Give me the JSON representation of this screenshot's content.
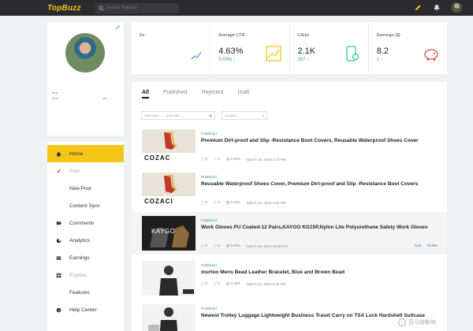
{
  "header": {
    "logo": "TopBuzz",
    "search_placeholder": "Search Topbuzz"
  },
  "profile": {
    "stat_left_label": "fans",
    "stat_left_value": "Burs",
    "stat_right_value": "ath"
  },
  "sidebar": {
    "items": [
      {
        "label": "Home"
      },
      {
        "label": "Post"
      },
      {
        "label": "New Post"
      },
      {
        "label": "Content Sync"
      },
      {
        "label": "Comments"
      },
      {
        "label": "Analytics"
      },
      {
        "label": "Earnings"
      },
      {
        "label": "Explore"
      },
      {
        "label": "Features"
      },
      {
        "label": "Help Center"
      }
    ]
  },
  "stats": {
    "first": {
      "label": "Ex"
    },
    "ctr": {
      "label": "Average CTR",
      "value": "4.63%",
      "sub": "0.03%"
    },
    "clicks": {
      "label": "Clicks",
      "value": "2.1K",
      "sub": "307"
    },
    "earnings": {
      "label": "Earnings ($)",
      "value": "8.2",
      "sub": "1"
    }
  },
  "tabs": [
    "All",
    "Published",
    "Rejected",
    "Draft"
  ],
  "filters": {
    "start": "Start Date",
    "end": "End Date",
    "types": "All types"
  },
  "posts": [
    {
      "status": "Published",
      "title": "Premium Dirt-proof and Slip -Resistance Boot Covers,  Reusable Waterproof Shoes Cover",
      "comments": "0",
      "likes": "0",
      "ctr": "2.84%",
      "date": "March 19, 2019 7:10 PM",
      "thumb_text": "COZAC"
    },
    {
      "status": "Published",
      "title": "Reusable Waterproof Shoes Cover, Premium Dirt-proof and Slip -Resistance Boot Covers",
      "comments": "0",
      "likes": "0",
      "ctr": "0.00%",
      "date": "March 19, 2019 4:32 PM",
      "thumb_text": "COZACI"
    },
    {
      "status": "Published",
      "title": "Work Gloves PU Coated-12 Pairs,KAYGO KG15P,Nylon Lite Polyurethane Safety Work Gloves",
      "comments": "0",
      "likes": "0",
      "ctr": "5.08%",
      "date": "March 16, 2019 12:38 PM",
      "thumb_text": "KAYGO",
      "edit": "Edit",
      "delete": "Delete"
    },
    {
      "status": "Published",
      "title": "murtoo Mens Bead Leather Bracelet, Blue and Brown Bead",
      "comments": "0",
      "likes": "0",
      "ctr": "0.00%",
      "date": "March 14, 2019 9:35 PM"
    },
    {
      "status": "Published",
      "title": "Newest Trolley Luggage Lightweight Business Travel Carry on TSA Lock Hardshell Suitcase",
      "comments": "",
      "likes": "",
      "ctr": "",
      "date": ""
    }
  ],
  "watermark": "亚马逊影响"
}
